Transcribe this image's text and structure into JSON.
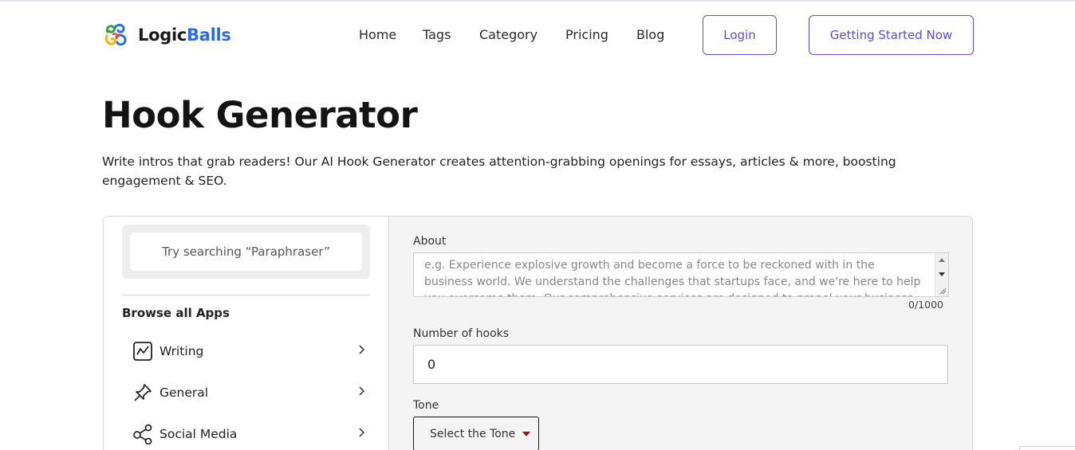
{
  "header": {
    "logo_part1": "Logic",
    "logo_part2": "Balls",
    "nav": [
      "Home",
      "Tags",
      "Category",
      "Pricing",
      "Blog"
    ],
    "login_label": "Login",
    "cta_label": "Getting Started Now",
    "accent_color": "#5a4fd6"
  },
  "page": {
    "title": "Hook Generator",
    "description": "Write intros that grab readers! Our AI Hook Generator creates attention-grabbing openings for essays, articles & more, boosting engagement & SEO."
  },
  "sidebar": {
    "search_placeholder": "Try searching “Paraphraser”",
    "browse_label": "Browse all Apps",
    "categories": [
      {
        "label": "Writing",
        "icon": "chart-icon"
      },
      {
        "label": "General",
        "icon": "pin-icon"
      },
      {
        "label": "Social Media",
        "icon": "share-icon"
      }
    ]
  },
  "form": {
    "about_label": "About",
    "about_placeholder": "e.g. Experience explosive growth and become a force to be reckoned with in the business world. We understand the challenges that startups face, and we're here to help you overcome them. Our comprehensive services are designed to propel your business forward",
    "about_counter": "0/1000",
    "hooks_label": "Number of hooks",
    "hooks_value": "0",
    "tone_label": "Tone",
    "tone_select": "Select the Tone"
  }
}
